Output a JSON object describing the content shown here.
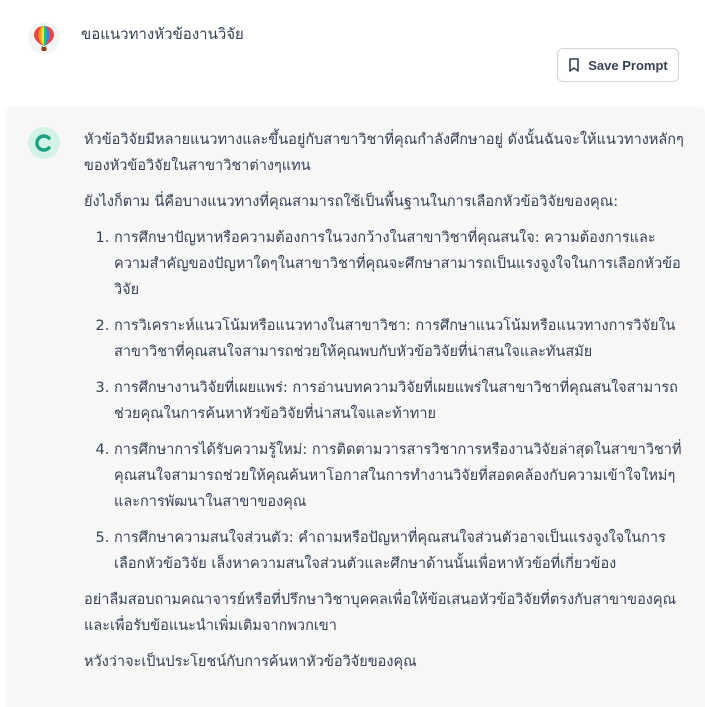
{
  "user": {
    "avatar_icon": "balloon-avatar-icon",
    "message": "ขอแนวทางหัวข้องานวิจัย"
  },
  "toolbar": {
    "save_prompt_label": "Save Prompt",
    "save_prompt_icon": "bookmark-icon"
  },
  "assistant": {
    "avatar_icon": "c-logo-icon",
    "intro": "หัวข้อวิจัยมีหลายแนวทางและขึ้นอยู่กับสาขาวิชาที่คุณกำลังศึกษาอยู่ ดังนั้นฉันจะให้แนวทางหลักๆของหัวข้อวิจัยในสาขาวิชาต่างๆแทน",
    "lead": "ยังไงก็ตาม นี่คือบางแนวทางที่คุณสามารถใช้เป็นพื้นฐานในการเลือกหัวข้อวิจัยของคุณ:",
    "items": [
      "การศึกษาปัญหาหรือความต้องการในวงกว้างในสาขาวิชาที่คุณสนใจ: ความต้องการและความสำคัญของปัญหาใดๆในสาขาวิชาที่คุณจะศึกษาสามารถเป็นแรงจูงใจในการเลือกหัวข้อวิจัย",
      "การวิเคราะห์แนวโน้มหรือแนวทางในสาขาวิชา: การศึกษาแนวโน้มหรือแนวทางการวิจัยในสาขาวิชาที่คุณสนใจสามารถช่วยให้คุณพบกับหัวข้อวิจัยที่น่าสนใจและทันสมัย",
      "การศึกษางานวิจัยที่เผยแพร่: การอ่านบทความวิจัยที่เผยแพร่ในสาขาวิชาที่คุณสนใจสามารถช่วยคุณในการค้นหาหัวข้อวิจัยที่น่าสนใจและท้าทาย",
      "การศึกษาการได้รับความรู้ใหม่: การติดตามวารสารวิชาการหรืองานวิจัยล่าสุดในสาขาวิชาที่คุณสนใจสามารถช่วยให้คุณค้นหาโอกาสในการทำงานวิจัยที่สอดคล้องกับความเข้าใจใหม่ๆและการพัฒนาในสาขาของคุณ",
      "การศึกษาความสนใจส่วนตัว: คำถามหรือปัญหาที่คุณสนใจส่วนตัวอาจเป็นแรงจูงใจในการเลือกหัวข้อวิจัย เล็งหาความสนใจส่วนตัวและศึกษาด้านนั้นเพื่อหาหัวข้อที่เกี่ยวข้อง"
    ],
    "advice": "อย่าลืมสอบถามคณาจารย์หรือที่ปรึกษาวิชาบุคคลเพื่อให้ข้อเสนอหัวข้อวิจัยที่ตรงกับสาขาของคุณและเพื่อรับข้อแนะนำเพิ่มเติมจากพวกเขา",
    "closing": "หวังว่าจะเป็นประโยชน์กับการค้นหาหัวข้อวิจัยของคุณ"
  },
  "colors": {
    "response_bg": "#f7f7f8",
    "bot_avatar_bg": "#d5f2e8",
    "bot_avatar_fg": "#19a37f",
    "text": "#374151",
    "button_border": "#d1d5db"
  }
}
